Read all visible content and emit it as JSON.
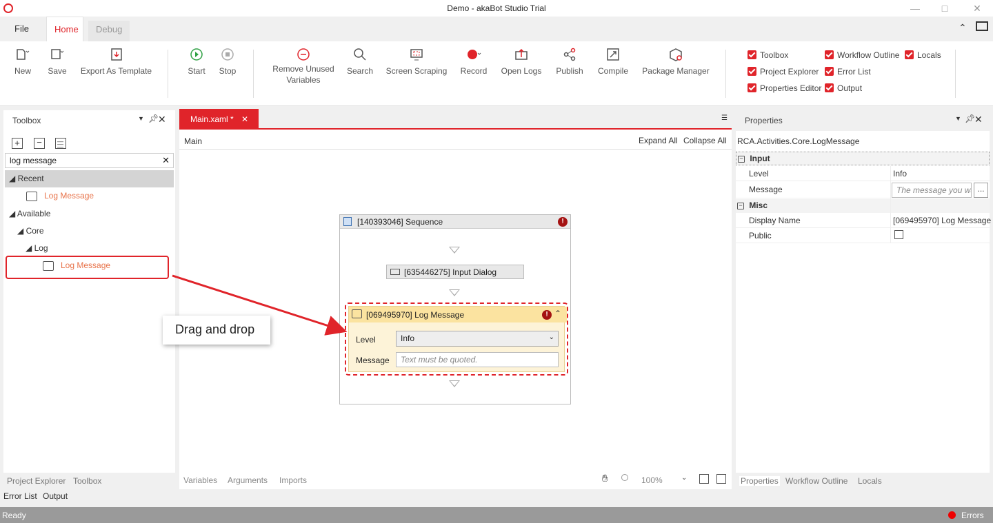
{
  "window": {
    "title": "Demo - akaBot Studio Trial"
  },
  "menu": {
    "tabs": [
      "File",
      "Home",
      "Debug"
    ]
  },
  "ribbon": {
    "buttons": {
      "new": "New",
      "save": "Save",
      "export": "Export As Template",
      "start": "Start",
      "stop": "Stop",
      "remove_unused": "Remove Unused",
      "remove_unused2": "Variables",
      "search": "Search",
      "screen_scraping": "Screen Scraping",
      "record": "Record",
      "open_logs": "Open Logs",
      "publish": "Publish",
      "compile": "Compile",
      "package_manager": "Package Manager"
    },
    "checkboxes": [
      "Toolbox",
      "Workflow Outline",
      "Locals",
      "Project Explorer",
      "Error List",
      "Properties Editor",
      "Output"
    ]
  },
  "toolbox": {
    "title": "Toolbox",
    "search_value": "log message",
    "recent": "Recent",
    "recent_item": "Log Message",
    "available": "Available",
    "core": "Core",
    "log": "Log",
    "log_item": "Log Message",
    "bottom_tabs": [
      "Project Explorer",
      "Toolbox"
    ],
    "bottom_tabs2": [
      "Error List",
      "Output"
    ]
  },
  "designer": {
    "tab": "Main.xaml *",
    "breadcrumb": "Main",
    "expand_all": "Expand All",
    "collapse_all": "Collapse All",
    "sequence": "[140393046] Sequence",
    "input_dialog": "[635446275] Input Dialog",
    "log_message": "[069495970] Log Message",
    "level_label": "Level",
    "level_value": "Info",
    "message_label": "Message",
    "message_placeholder": "Text must be quoted.",
    "annotation": "Drag and drop",
    "bottom_tabs": [
      "Variables",
      "Arguments",
      "Imports"
    ],
    "zoom": "100%"
  },
  "properties": {
    "title": "Properties",
    "type": "RCA.Activities.Core.LogMessage",
    "input": "Input",
    "level_label": "Level",
    "level_value": "Info",
    "message_label": "Message",
    "message_placeholder": "The message you wa",
    "misc": "Misc",
    "display_name_label": "Display Name",
    "display_name_value": "[069495970] Log Message",
    "public_label": "Public",
    "bottom_tabs": [
      "Properties",
      "Workflow Outline",
      "Locals"
    ]
  },
  "status": {
    "left": "Ready",
    "right": "Errors"
  }
}
